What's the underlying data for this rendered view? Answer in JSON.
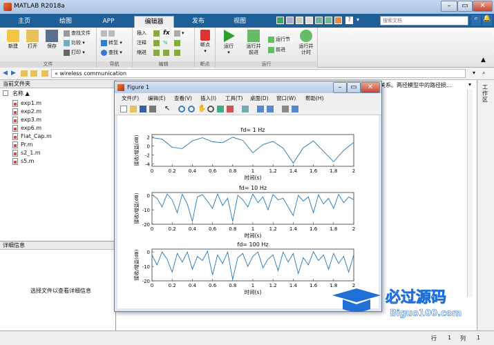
{
  "window": {
    "title": "MATLAB R2018a"
  },
  "tabs": [
    {
      "label": "主页"
    },
    {
      "label": "绘图"
    },
    {
      "label": "APP"
    },
    {
      "label": "编辑器"
    },
    {
      "label": "发布"
    },
    {
      "label": "视图"
    }
  ],
  "search": {
    "placeholder": "搜索文档"
  },
  "toolstrip": {
    "file": {
      "label": "文件",
      "new": "新建",
      "open": "打开",
      "save": "保存",
      "find_files": "查找文件",
      "compare": "比较",
      "print": "打印"
    },
    "nav": {
      "label": "导航",
      "goto": "转至",
      "find": "查找"
    },
    "edit": {
      "label": "编辑",
      "insert": "插入",
      "comment": "注释",
      "indent": "缩进",
      "fx": "fx"
    },
    "breakpoint": {
      "label": "断点",
      "breakpoints": "断点"
    },
    "run": {
      "label": "运行",
      "run": "运行",
      "run_advance": "运行并\n前进",
      "run_section": "运行节",
      "advance": "前进",
      "run_time": "运行并\n计时"
    }
  },
  "address": {
    "path": "«  wireless communication"
  },
  "current_folder": {
    "title": "当前文件夹",
    "column": "名称 ▲",
    "files": [
      "exp1.m",
      "exp2.m",
      "exp3.m",
      "exp6.m",
      "Flat_Cap.m",
      "Pr.m",
      "s2_1.m",
      "s5.m"
    ]
  },
  "details": {
    "title": "详细信息",
    "message": "选择文件以查看详细信息"
  },
  "cmd": {
    "text": "关系。两径模型中的路径损..."
  },
  "workspace": {
    "title": "工作区"
  },
  "status": {
    "row_label": "行",
    "row": "1",
    "col_label": "列",
    "col": "1"
  },
  "figure": {
    "title": "Figure 1",
    "menu": [
      "文件(F)",
      "编辑(E)",
      "查看(V)",
      "插入(I)",
      "工具(T)",
      "桌面(D)",
      "窗口(W)",
      "帮助(H)"
    ]
  },
  "chart_data": [
    {
      "type": "line",
      "title": "fd= 1 Hz",
      "xlabel": "时间(s)",
      "ylabel": "接收/增益(dB)",
      "xlim": [
        0,
        2
      ],
      "ylim": [
        -4.5,
        2.5
      ],
      "xticks": [
        "0",
        "0.2",
        "0.4",
        "0.6",
        "0.8",
        "1",
        "1.2",
        "1.4",
        "1.6",
        "1.8",
        "2"
      ],
      "yticks": [
        "2",
        "0",
        "-2",
        "-4"
      ],
      "x": [
        0,
        0.1,
        0.2,
        0.3,
        0.4,
        0.5,
        0.6,
        0.7,
        0.8,
        0.9,
        1.0,
        1.1,
        1.2,
        1.3,
        1.4,
        1.5,
        1.6,
        1.7,
        1.8,
        1.9,
        2.0
      ],
      "y": [
        1.8,
        1.5,
        -0.3,
        -0.6,
        1.1,
        1.8,
        0.9,
        0.7,
        1.9,
        1.2,
        -1.5,
        0.3,
        1.0,
        -0.5,
        -3.8,
        -0.4,
        1.1,
        -1.2,
        -3.5,
        -1.0,
        0.8
      ]
    },
    {
      "type": "line",
      "title": "fd= 10 Hz",
      "xlabel": "时间(s)",
      "ylabel": "接收/增益(dB)",
      "xlim": [
        0,
        2
      ],
      "ylim": [
        -20,
        2
      ],
      "xticks": [
        "0",
        "0.2",
        "0.4",
        "0.6",
        "0.8",
        "1",
        "1.2",
        "1.4",
        "1.6",
        "1.8",
        "2"
      ],
      "yticks": [
        "0",
        "-10",
        "-20"
      ],
      "x": [
        0,
        0.05,
        0.1,
        0.15,
        0.2,
        0.25,
        0.3,
        0.35,
        0.4,
        0.45,
        0.5,
        0.55,
        0.6,
        0.65,
        0.7,
        0.75,
        0.8,
        0.85,
        0.9,
        0.95,
        1.0,
        1.05,
        1.1,
        1.15,
        1.2,
        1.25,
        1.3,
        1.35,
        1.4,
        1.45,
        1.5,
        1.55,
        1.6,
        1.65,
        1.7,
        1.75,
        1.8,
        1.85,
        1.9,
        1.95,
        2.0
      ],
      "y": [
        0.5,
        -2,
        -8,
        1,
        -3,
        -12,
        0.8,
        -6,
        -18,
        -1,
        0.5,
        -4,
        -9,
        1,
        -7,
        -2,
        -18,
        0,
        -3,
        -8,
        1,
        -5,
        -1,
        -10,
        0.6,
        -3,
        -2,
        -8,
        -14,
        0,
        -4,
        -1,
        -12,
        0.4,
        -6,
        -2,
        -9,
        0.7,
        -5,
        -1,
        -3
      ]
    },
    {
      "type": "line",
      "title": "fd= 100 Hz",
      "xlabel": "时间(s)",
      "ylabel": "接收/增益(dB)",
      "xlim": [
        0,
        2
      ],
      "ylim": [
        -20,
        2
      ],
      "xticks": [
        "0",
        "0.2",
        "0.4",
        "0.6",
        "0.8",
        "1",
        "1.2",
        "1.4",
        "1.6",
        "1.8",
        "2"
      ],
      "yticks": [
        "0",
        "-10",
        "-20"
      ],
      "x": [
        0,
        0.05,
        0.1,
        0.15,
        0.2,
        0.25,
        0.3,
        0.35,
        0.4,
        0.45,
        0.5,
        0.55,
        0.6,
        0.65,
        0.7,
        0.75,
        0.8,
        0.85,
        0.9,
        0.95,
        1.0,
        1.05,
        1.1,
        1.15,
        1.2,
        1.25,
        1.3,
        1.35,
        1.4,
        1.45,
        1.5,
        1.55,
        1.6,
        1.65,
        1.7,
        1.75,
        1.8,
        1.85,
        1.9,
        1.95,
        2.0
      ],
      "y": [
        -2,
        -9,
        0,
        -5,
        -14,
        -1,
        -7,
        0,
        -12,
        -3,
        -6,
        0.5,
        -16,
        -2,
        -8,
        0,
        -19,
        -4,
        -1,
        -10,
        -3,
        0,
        -11,
        -5,
        -2,
        -13,
        0,
        -7,
        -1,
        -15,
        -4,
        -9,
        0.3,
        -6,
        -2,
        -12,
        -1,
        -8,
        -3,
        -14,
        -2
      ]
    }
  ]
}
